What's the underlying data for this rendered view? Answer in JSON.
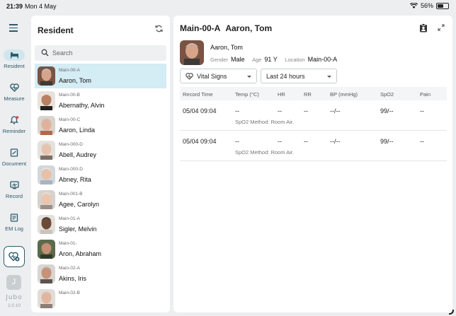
{
  "status": {
    "time": "21:39",
    "date": "Mon 4 May",
    "battery": "56%",
    "battery_level": 0.56
  },
  "nav": {
    "items": [
      {
        "label": "Resident",
        "icon": "bed-icon"
      },
      {
        "label": "Measure",
        "icon": "heart-pulse-icon"
      },
      {
        "label": "Reminder",
        "icon": "bell-icon"
      },
      {
        "label": "Document",
        "icon": "document-icon"
      },
      {
        "label": "Record",
        "icon": "monitor-icon"
      },
      {
        "label": "EM Log",
        "icon": "log-icon"
      }
    ],
    "avatar_initial": "J",
    "brand": "Jubo",
    "version": "2.0.10"
  },
  "residents": {
    "title": "Resident",
    "search_placeholder": "Search",
    "list": [
      {
        "bed": "Main-00-A",
        "name": "Aaron, Tom"
      },
      {
        "bed": "Main-00-B",
        "name": "Abernathy, Alvin"
      },
      {
        "bed": "Main-00-C",
        "name": "Aaron, Linda"
      },
      {
        "bed": "Main-000-D",
        "name": "Abell, Audrey"
      },
      {
        "bed": "Main-000-D",
        "name": "Abney, Rita"
      },
      {
        "bed": "Main-001-B",
        "name": "Agee, Carolyn"
      },
      {
        "bed": "Main-01-A",
        "name": "Sigler, Melvin"
      },
      {
        "bed": "Main-01-",
        "name": "Aron, Abraham"
      },
      {
        "bed": "Main-02-A",
        "name": "Akins, Iris"
      },
      {
        "bed": "Main-02-B",
        "name": ""
      }
    ]
  },
  "detail": {
    "bed": "Main-00-A",
    "name": "Aaron, Tom",
    "gender_label": "Gender",
    "gender": "Male",
    "age_label": "Age",
    "age": "91 Y",
    "location_label": "Location",
    "location": "Main-00-A",
    "type_select": "Vital Signs",
    "range_select": "Last 24 hours",
    "columns": [
      "Record Time",
      "Temp (°C)",
      "HR",
      "RR",
      "BP (mmHg)",
      "SpO2",
      "Pain"
    ],
    "rows": [
      {
        "time": "05/04 09:04",
        "temp": "--",
        "hr": "--",
        "rr": "--",
        "bp": "--/--",
        "spo2": "99/--",
        "pain": "--",
        "note": "SpO2 Method: Room Air."
      },
      {
        "time": "05/04 09:04",
        "temp": "--",
        "hr": "--",
        "rr": "--",
        "bp": "--/--",
        "spo2": "99/--",
        "pain": "--",
        "note": "SpO2 Method: Room Air."
      }
    ]
  },
  "colors": {
    "accent": "#2d5a6a",
    "selected_row": "#d4ecf3",
    "background": "#eceef0"
  }
}
